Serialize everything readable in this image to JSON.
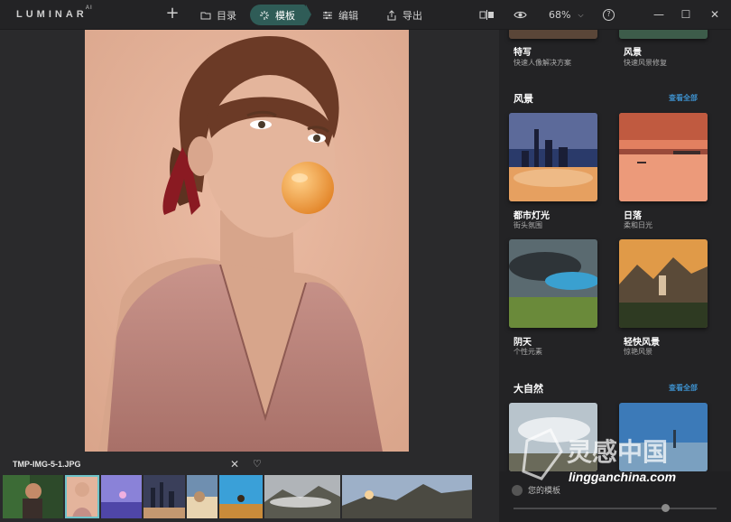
{
  "app": {
    "logo": "LUMINAR",
    "logo_sup": "AI"
  },
  "toolbar": {
    "add_label": "+",
    "tabs": [
      {
        "label": "目录",
        "icon": "folder-icon"
      },
      {
        "label": "模板",
        "icon": "sparkle-icon",
        "active": true
      },
      {
        "label": "编辑",
        "icon": "sliders-icon"
      },
      {
        "label": "导出",
        "icon": "export-icon"
      }
    ],
    "zoom": "68%",
    "help": "?",
    "accent": "#2f5c57"
  },
  "filmstrip": {
    "filename": "TMP-IMG-5-1.JPG",
    "close_glyph": "✕",
    "heart_glyph": "♡"
  },
  "panel": {
    "top_cards": [
      {
        "title": "特写",
        "subtitle": "快速人像解决方案"
      },
      {
        "title": "风景",
        "subtitle": "快速风景修复"
      }
    ],
    "sections": [
      {
        "title": "风景",
        "see_all": "查看全部",
        "cards": [
          {
            "title": "都市灯光",
            "subtitle": "街头氛围"
          },
          {
            "title": "日落",
            "subtitle": "柔和日光"
          },
          {
            "title": "阴天",
            "subtitle": "个性元素"
          },
          {
            "title": "轻快风景",
            "subtitle": "惊艳风景"
          }
        ]
      },
      {
        "title": "大自然",
        "see_all": "查看全部"
      }
    ],
    "my_templates": "您的模板",
    "link_color": "#3d8ec9"
  },
  "watermark": {
    "text_cn": "灵感中国",
    "text_en": "lingganchina.com"
  }
}
